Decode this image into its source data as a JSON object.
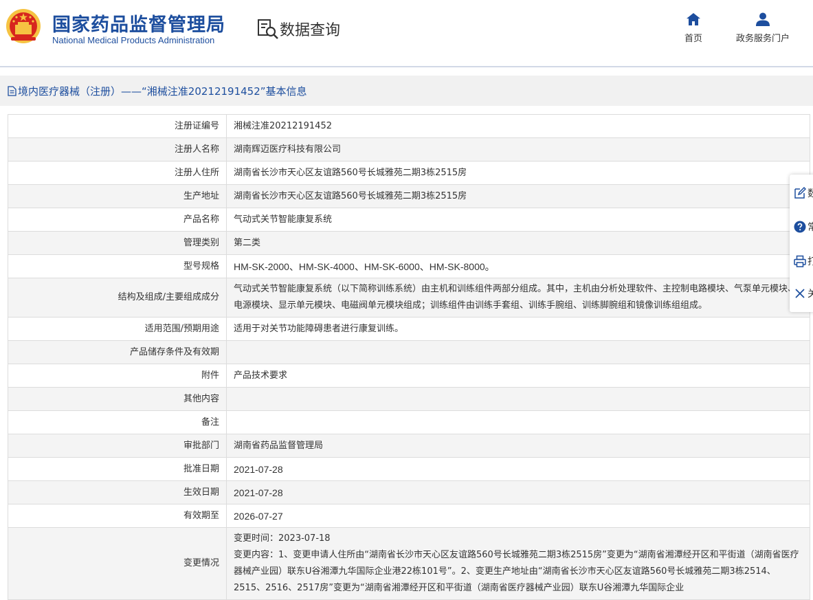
{
  "header": {
    "title_cn": "国家药品监督管理局",
    "title_en": "National Medical Products Administration",
    "section_title": "数据查询",
    "nav": [
      {
        "label": "首页",
        "icon": "home-icon"
      },
      {
        "label": "政务服务门户",
        "icon": "user-icon"
      }
    ]
  },
  "breadcrumb": "境内医疗器械（注册）——“湘械注准20212191452”基本信息",
  "rows": [
    {
      "label": "注册证编号",
      "value": "湘械注准20212191452"
    },
    {
      "label": "注册人名称",
      "value": "湖南辉迈医疗科技有限公司"
    },
    {
      "label": "注册人住所",
      "value": "湖南省长沙市天心区友谊路560号长城雅苑二期3栋2515房"
    },
    {
      "label": "生产地址",
      "value": "湖南省长沙市天心区友谊路560号长城雅苑二期3栋2515房"
    },
    {
      "label": "产品名称",
      "value": "气动式关节智能康复系统"
    },
    {
      "label": "管理类别",
      "value": "第二类"
    },
    {
      "label": "型号规格",
      "value": "HM-SK-2000、HM-SK-4000、HM-SK-6000、HM-SK-8000。"
    },
    {
      "label": "结构及组成/主要组成成分",
      "value": "气动式关节智能康复系统（以下简称训练系统）由主机和训练组件两部分组成。其中，主机由分析处理软件、主控制电路模块、气泵单元模块、电源模块、显示单元模块、电磁阀单元模块组成；训练组件由训练手套组、训练手腕组、训练脚腕组和镜像训练组组成。"
    },
    {
      "label": "适用范围/预期用途",
      "value": "适用于对关节功能障碍患者进行康复训练。"
    },
    {
      "label": "产品储存条件及有效期",
      "value": ""
    },
    {
      "label": "附件",
      "value": "产品技术要求"
    },
    {
      "label": "其他内容",
      "value": ""
    },
    {
      "label": "备注",
      "value": ""
    },
    {
      "label": "审批部门",
      "value": "湖南省药品监督管理局"
    },
    {
      "label": "批准日期",
      "value": "2021-07-28"
    },
    {
      "label": "生效日期",
      "value": "2021-07-28"
    },
    {
      "label": "有效期至",
      "value": "2026-07-27"
    }
  ],
  "change": {
    "label": "变更情况",
    "time": "变更时间：2023-07-18",
    "content": "变更内容：1、变更申请人住所由“湖南省长沙市天心区友谊路560号长城雅苑二期3栋2515房”变更为“湖南省湘潭经开区和平街道（湖南省医疗器械产业园）联东U谷湘潭九华国际企业港22栋101号”。2、变更生产地址由“湖南省长沙市天心区友谊路560号长城雅苑二期3栋2514、2515、2516、2517房”变更为“湖南省湘潭经开区和平街道（湖南省医疗器械产业园）联东U谷湘潭九华国际企业"
  },
  "sidebar": [
    {
      "label": "数",
      "icon": "edit-icon"
    },
    {
      "label": "常",
      "icon": "help-icon"
    },
    {
      "label": "打",
      "icon": "print-icon"
    },
    {
      "label": "关",
      "icon": "close-icon"
    }
  ],
  "colors": {
    "brand": "#1d4e9e",
    "emblem_red": "#d7261e",
    "emblem_gold": "#f6c342"
  }
}
